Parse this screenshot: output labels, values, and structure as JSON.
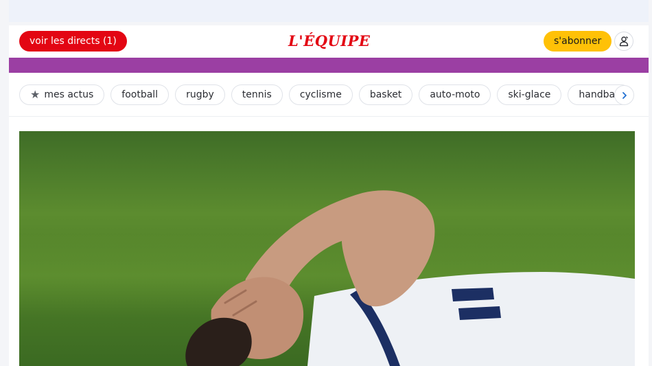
{
  "header": {
    "live_label": "voir les directs (1)",
    "logo_text": "L'ÉQUIPE",
    "subscribe_label": "s'abonner",
    "account_icon": "user-icon"
  },
  "nav": {
    "chips": [
      {
        "label": "mes actus",
        "icon": "star-icon"
      },
      {
        "label": "football"
      },
      {
        "label": "rugby"
      },
      {
        "label": "tennis"
      },
      {
        "label": "cyclisme"
      },
      {
        "label": "basket"
      },
      {
        "label": "auto-moto"
      },
      {
        "label": "ski-glace"
      },
      {
        "label": "handball"
      }
    ],
    "next_icon": "chevron-right-icon"
  },
  "hero": {
    "image": "rugby-player-lying-on-pitch"
  },
  "colors": {
    "brand_red": "#e30613",
    "subscribe_yellow": "#ffc107",
    "accent_purple": "#9b3fa3",
    "chevron_blue": "#1f6fd1"
  }
}
